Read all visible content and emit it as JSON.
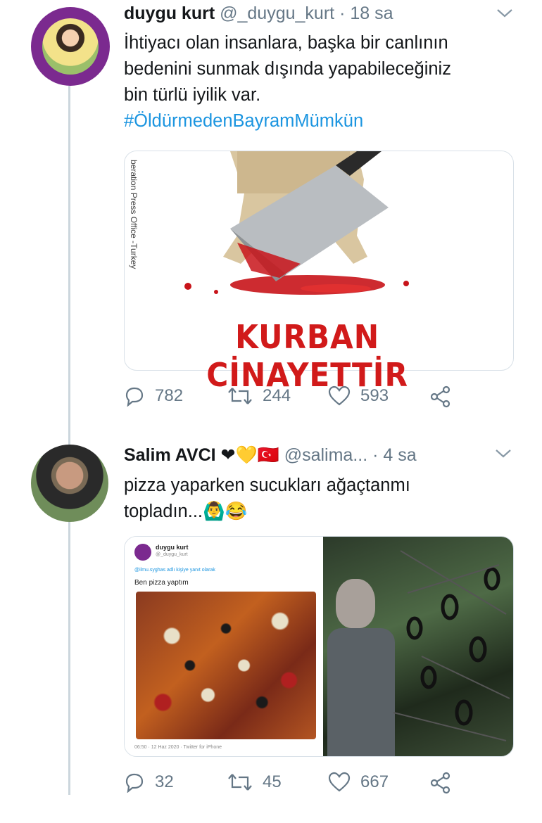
{
  "tweet1": {
    "name": "duygu kurt",
    "handle": "@_duygu_kurt",
    "dot": "·",
    "time": "18 sa",
    "text_lines": [
      "İhtiyacı olan insanlara, başka bir canlının",
      "bedenini sunmak dışında yapabileceğiniz",
      "bin türlü iyilik var."
    ],
    "hashtag": "#ÖldürmedenBayramMümkün",
    "image": {
      "side_text": "beration Press Office -Turkey",
      "headline": "KURBAN CİNAYETTİR"
    },
    "actions": {
      "replies": "782",
      "retweets": "244",
      "likes": "593"
    }
  },
  "tweet2": {
    "name": "Salim AVCI",
    "emoji": "❤💛🇹🇷",
    "handle": "@salima...",
    "dot": "·",
    "time": "4 sa",
    "text_lines": [
      "pizza yaparken sucukları ağaçtanmı",
      "topladın...🙆‍♂️😂"
    ],
    "card": {
      "name": "duygu kurt",
      "handle": "@_duygu_kurt",
      "reply": "@ilmu.syghas adlı kişiye yanıt olarak",
      "text": "Ben pizza yaptım",
      "footer": "06:50 · 12 Haz 2020 · Twitter for iPhone"
    },
    "actions": {
      "replies": "32",
      "retweets": "45",
      "likes": "667"
    }
  },
  "colors": {
    "accent": "#1b95e0",
    "headline": "#d11a1a",
    "muted": "#657786"
  }
}
